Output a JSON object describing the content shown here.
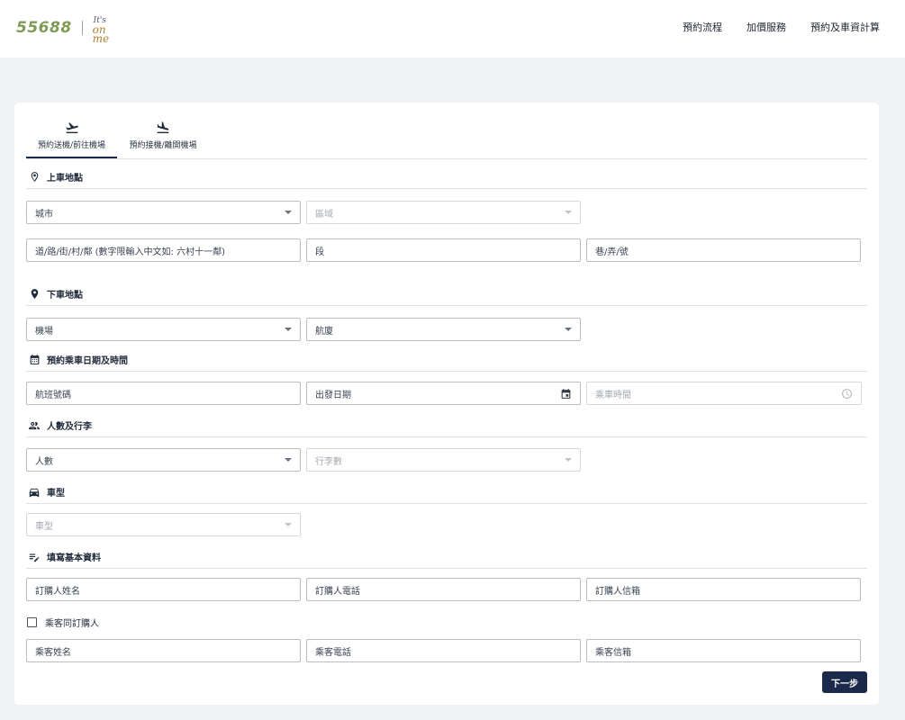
{
  "brand": {
    "logo_text": "55688",
    "tagline_small": "It's",
    "tagline_main": "on me"
  },
  "nav": {
    "items": [
      "預約流程",
      "加價服務",
      "預約及車資計算"
    ]
  },
  "tabs": {
    "dropoff_label": "預約送機/前往機場",
    "pickup_label": "預約接機/離開機場",
    "active": "dropoff"
  },
  "sections": {
    "pickup_location": "上車地點",
    "dropoff_location": "下車地點",
    "datetime": "預約乘車日期及時間",
    "passengers": "人數及行李",
    "car_type": "車型",
    "basic_info": "填寫基本資料"
  },
  "fields": {
    "city": "城市",
    "district": "區域",
    "street": "道/路/街/村/鄰 (數字限輸入中文如: 六村十一鄰)",
    "section_no": "段",
    "lane_no": "巷/弄/號",
    "airport": "機場",
    "terminal": "航廈",
    "flight_no": "航班號碼",
    "departure_date": "出發日期",
    "ride_time": "乘車時間",
    "people_count": "人數",
    "luggage_count": "行李數",
    "car_type": "車型",
    "buyer_name": "訂購人姓名",
    "buyer_phone": "訂購人電話",
    "buyer_email": "訂購人信箱",
    "passenger_name": "乘客姓名",
    "passenger_phone": "乘客電話",
    "passenger_email": "乘客信箱"
  },
  "checkbox": {
    "same_as_buyer": "乘客同訂購人",
    "checked": false
  },
  "buttons": {
    "next": "下一步"
  },
  "colors": {
    "brand_green": "#7f9b55",
    "primary_navy": "#1b2a4a",
    "page_bg": "#f0f1f3"
  }
}
